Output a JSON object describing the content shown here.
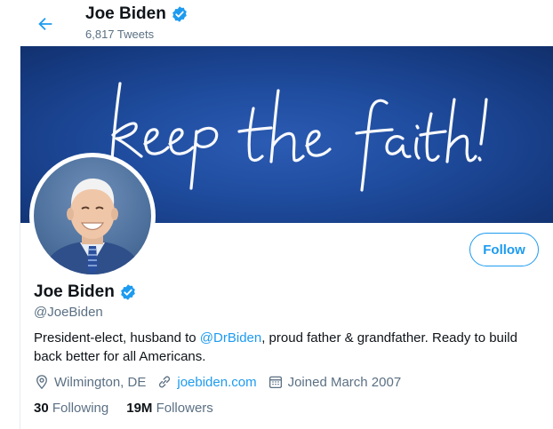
{
  "header": {
    "name": "Joe Biden",
    "tweet_count": "6,817 Tweets"
  },
  "banner": {
    "text": "keep the faith!",
    "color": "#1f4c9e"
  },
  "profile": {
    "name": "Joe Biden",
    "handle": "@JoeBiden",
    "bio_part1": "President-elect, husband to ",
    "bio_mention": "@DrBiden",
    "bio_part2": ", proud father & grandfather. Ready to build back better for all Americans.",
    "location": "Wilmington, DE",
    "website": "joebiden.com",
    "joined": "Joined March 2007",
    "following_count": "30",
    "following_label": "Following",
    "followers_count": "19M",
    "followers_label": "Followers"
  },
  "actions": {
    "follow_label": "Follow"
  },
  "colors": {
    "accent": "#1d9bf0",
    "muted": "#5b7083"
  }
}
